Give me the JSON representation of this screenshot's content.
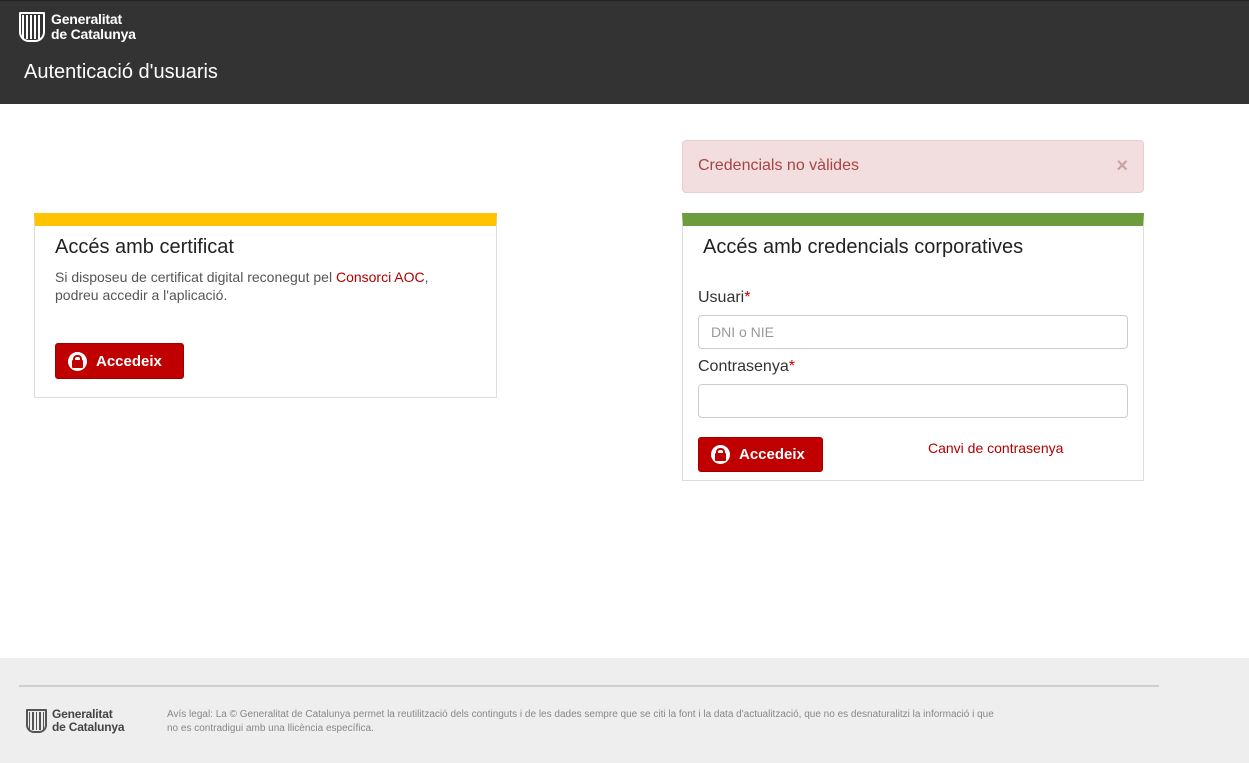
{
  "header": {
    "brand_line1": "Generalitat",
    "brand_line2": "de Catalunya",
    "title": "Autenticació d'usuaris"
  },
  "alert": {
    "message": "Credencials no vàlides",
    "close_symbol": "×"
  },
  "certificate_panel": {
    "accent_color": "#ffc300",
    "title": "Accés amb certificat",
    "desc_before": "Si disposeu de certificat digital reconegut pel ",
    "desc_link": "Consorci AOC",
    "desc_after": ", podreu accedir a l'aplicació.",
    "button_label": "Accedeix",
    "button_icon": "lock-icon"
  },
  "credentials_panel": {
    "accent_color": "#6c9c3c",
    "title": "Accés amb credencials corporatives",
    "user_label": "Usuari",
    "user_placeholder": "DNI o NIE",
    "user_value": "",
    "password_label": "Contrasenya",
    "password_value": "",
    "required_mark": "*",
    "button_label": "Accedeix",
    "button_icon": "lock-icon",
    "change_password_link": "Canvi de contrasenya"
  },
  "footer": {
    "brand_line1": "Generalitat",
    "brand_line2": "de Catalunya",
    "legal_text": "Avís legal: La © Generalitat de Catalunya permet la reutilització dels continguts i de les dades sempre que se citi la font i la data d'actualització, que no es desnaturalitzi la informació i que no es contradigui amb una llicència específica."
  },
  "colors": {
    "header_bg": "#333333",
    "primary_button": "#c00000",
    "alert_text": "#a94442",
    "alert_bg": "#f2dede"
  }
}
